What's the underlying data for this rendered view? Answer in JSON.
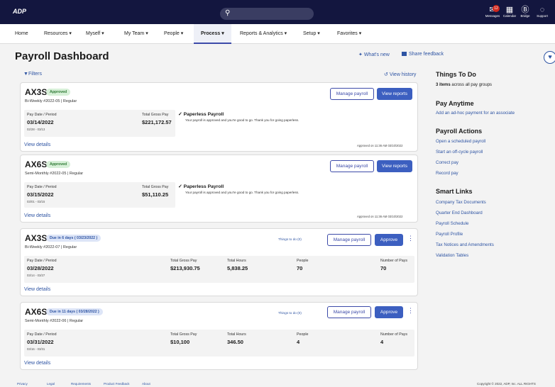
{
  "topbar": {
    "logo": "ADP",
    "icons": [
      {
        "name": "messages-icon",
        "label": "Messages",
        "glyph": "✉",
        "badge": "12"
      },
      {
        "name": "calendar-icon",
        "label": "Calendar",
        "glyph": "▦"
      },
      {
        "name": "bridge-icon",
        "label": "Bridge",
        "glyph": "Ⓑ"
      },
      {
        "name": "support-icon",
        "label": "Support",
        "glyph": "◌"
      }
    ]
  },
  "nav": [
    "Home",
    "Resources",
    "Myself",
    "My Team",
    "People",
    "Process",
    "Reports & Analytics",
    "Setup",
    "Favorites"
  ],
  "nav_active": "Process",
  "page": {
    "title": "Payroll Dashboard",
    "whats_new": "What's new",
    "share_feedback": "Share feedback",
    "filters": "Filters",
    "view_history": "View history"
  },
  "cards": [
    {
      "code": "AX3S",
      "status": "Approved",
      "sub": "Bi-Weekly #2022-05 | Regular",
      "period_label": "Pay Date / Period",
      "date": "03/14/2022",
      "range": "02/28 - 03/13",
      "gross_label": "Total Gross Pay",
      "gross": "$221,172.57",
      "paperless_title": "Paperless Payroll",
      "paperless_desc": "Your payroll is approved and you're good to go. Thank you for going paperless.",
      "view_details": "View details",
      "approved_on": "Approved on 11:36 AM 03/10/2022",
      "btn_manage": "Manage payroll",
      "btn_action": "View reports"
    },
    {
      "code": "AX6S",
      "status": "Approved",
      "sub": "Semi-Monthly #2022-05 | Regular",
      "period_label": "Pay Date / Period",
      "date": "03/15/2022",
      "range": "03/01 - 03/15",
      "gross_label": "Total Gross Pay",
      "gross": "$51,110.25",
      "paperless_title": "Paperless Payroll",
      "paperless_desc": "Your payroll is approved and you're good to go. Thank you for going paperless.",
      "view_details": "View details",
      "approved_on": "Approved on 11:36 AM 03/10/2022",
      "btn_manage": "Manage payroll",
      "btn_action": "View reports"
    },
    {
      "code": "AX3S",
      "status": "Due in 6 days ( 03/23/2022 )",
      "sub": "Bi-Weekly #2022-07 | Regular",
      "todo": "Things to do (0)",
      "period_label": "Pay Date / Period",
      "date": "03/28/2022",
      "range": "03/14 - 03/27",
      "gross_label": "Total Gross Pay",
      "gross": "$213,930.75",
      "hours_label": "Total Hours",
      "hours": "5,838.25",
      "people_label": "People",
      "people": "70",
      "pays_label": "Number of Pays",
      "pays": "70",
      "view_details": "View details",
      "btn_manage": "Manage payroll",
      "btn_action": "Approve"
    },
    {
      "code": "AX6S",
      "status": "Due in 11 days ( 03/28/2022 )",
      "sub": "Semi-Monthly #2022-06 | Regular",
      "todo": "Things to do (0)",
      "period_label": "Pay Date / Period",
      "date": "03/31/2022",
      "range": "03/16 - 03/31",
      "gross_label": "Total Gross Pay",
      "gross": "$10,100",
      "hours_label": "Total Hours",
      "hours": "346.50",
      "people_label": "People",
      "people": "4",
      "pays_label": "Number of Pays",
      "pays": "4",
      "view_details": "View details",
      "btn_manage": "Manage payroll",
      "btn_action": "Approve"
    }
  ],
  "sidebar": {
    "todo_title": "Things To Do",
    "todo_bold": "3 items",
    "todo_text": " across all pay groups",
    "pay_anytime_title": "Pay Anytime",
    "pay_anytime_link": "Add an ad-hoc payment for an associate",
    "actions_title": "Payroll Actions",
    "actions": [
      "Open a scheduled payroll",
      "Start an off-cycle payroll",
      "Correct pay",
      "Record pay"
    ],
    "smart_title": "Smart Links",
    "smart": [
      "Company Tax Documents",
      "Quarter End Dashboard",
      "Payroll Schedule",
      "Payroll Profile",
      "Tax Notices and Amendments",
      "Validation Tables"
    ]
  },
  "footer": {
    "links": [
      "Privacy",
      "Legal",
      "Requirements",
      "Product Feedback",
      "About"
    ],
    "copyright": "Copyright © 2022, ADP, Inc. ALL RIGHTS"
  },
  "colors": {
    "topbar": "#13163f",
    "accent": "#3c4aa8",
    "link": "#2e54a3",
    "approved": "#2f7a35"
  }
}
